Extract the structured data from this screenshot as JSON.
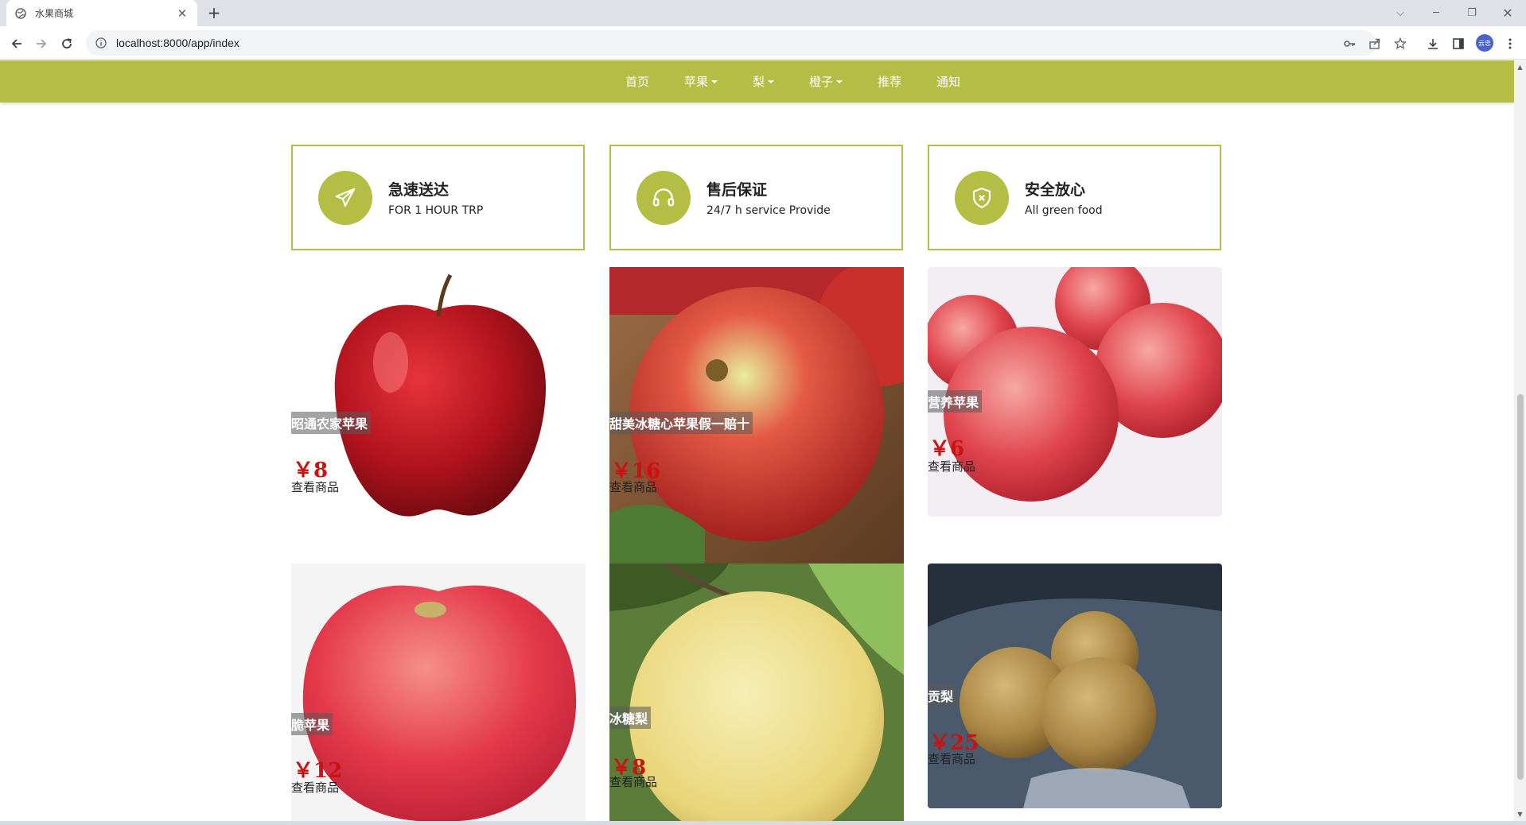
{
  "browser": {
    "tab_title": "水果商城",
    "url": "localhost:8000/app/index",
    "avatar_text": "云忠"
  },
  "nav": {
    "items": [
      {
        "label": "首页",
        "dropdown": false
      },
      {
        "label": "苹果",
        "dropdown": true
      },
      {
        "label": "梨",
        "dropdown": true
      },
      {
        "label": "橙子",
        "dropdown": true
      },
      {
        "label": "推荐",
        "dropdown": false
      },
      {
        "label": "通知",
        "dropdown": false
      }
    ],
    "background": "#b4bd44"
  },
  "features": [
    {
      "title": "急速送达",
      "subtitle": "FOR 1 HOUR TRP",
      "icon": "airplane-icon"
    },
    {
      "title": "售后保证",
      "subtitle": "24/7 h service Provide",
      "icon": "headset-icon"
    },
    {
      "title": "安全放心",
      "subtitle": "All green food",
      "icon": "shield-icon"
    }
  ],
  "products": [
    {
      "name": "昭通农家苹果",
      "price": "￥8",
      "link": "查看商品",
      "image": "red-apple-image"
    },
    {
      "name": "甜美冰糖心苹果假一赔十",
      "price": "￥16",
      "link": "查看商品",
      "image": "apple-closeup-image"
    },
    {
      "name": "营养苹果",
      "price": "￥6",
      "link": "查看商品",
      "image": "apples-group-image"
    },
    {
      "name": "脆苹果",
      "price": "￥12",
      "link": "查看商品",
      "image": "striped-apple-image"
    },
    {
      "name": "冰糖梨",
      "price": "￥8",
      "link": "查看商品",
      "image": "yellow-pear-image"
    },
    {
      "name": "贡梨",
      "price": "￥25",
      "link": "查看商品",
      "image": "brown-pears-image"
    }
  ],
  "colors": {
    "accent": "#b4bd44",
    "price": "#cc1111"
  }
}
